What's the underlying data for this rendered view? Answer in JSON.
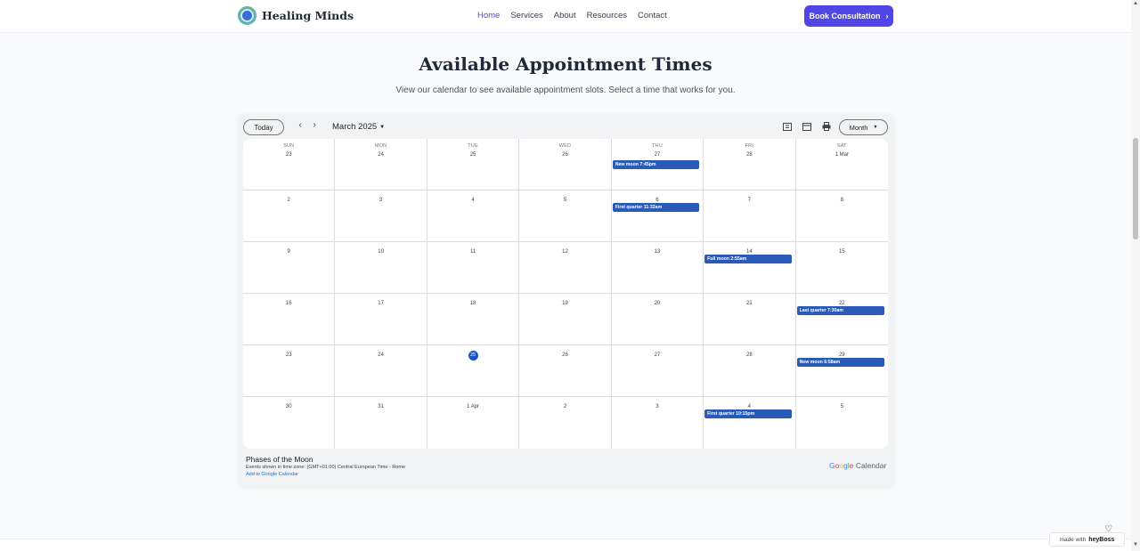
{
  "header": {
    "brand": "Healing Minds",
    "nav": [
      "Home",
      "Services",
      "About",
      "Resources",
      "Contact"
    ],
    "active_nav": "Home",
    "cta_label": "Book Consultation",
    "cta_icon": "chevron-right-icon",
    "accent_color": "#4f46e5"
  },
  "hero": {
    "title": "Available Appointment Times",
    "subtitle": "View our calendar to see available appointment slots. Select a time that works for you."
  },
  "calendar": {
    "today_label": "Today",
    "month_label": "March 2025",
    "view_label": "Month",
    "toolbar_icons": [
      "agenda-icon",
      "calendar-icon",
      "print-icon"
    ],
    "weekdays": [
      "SUN",
      "MON",
      "TUE",
      "WED",
      "THU",
      "FRI",
      "SAT"
    ],
    "weeks": [
      [
        "23",
        "24",
        "25",
        "26",
        "27",
        "28",
        "1 Mar"
      ],
      [
        "2",
        "3",
        "4",
        "5",
        "6",
        "7",
        "8"
      ],
      [
        "9",
        "10",
        "11",
        "12",
        "13",
        "14",
        "15"
      ],
      [
        "16",
        "17",
        "18",
        "19",
        "20",
        "21",
        "22"
      ],
      [
        "23",
        "24",
        "25",
        "26",
        "27",
        "28",
        "29"
      ],
      [
        "30",
        "31",
        "1 Apr",
        "2",
        "3",
        "4",
        "5"
      ]
    ],
    "today": {
      "week": 4,
      "day": 2
    },
    "events": [
      {
        "week": 0,
        "day": 4,
        "label": "New moon 7:45pm"
      },
      {
        "week": 1,
        "day": 4,
        "label": "First quarter 11:32am"
      },
      {
        "week": 2,
        "day": 5,
        "label": "Full moon 2:55am"
      },
      {
        "week": 3,
        "day": 6,
        "label": "Last quarter 7:30am"
      },
      {
        "week": 4,
        "day": 6,
        "label": "New moon 6:58am"
      },
      {
        "week": 5,
        "day": 5,
        "label": "First quarter 10:15pm"
      }
    ],
    "event_color": "#2a5ab8",
    "calendar_name": "Phases of the Moon",
    "timezone_note": "Events shown in time zone: (GMT+01:00) Central European Time - Rome",
    "add_link": "Add to Google Calendar",
    "brand_google": "Google",
    "brand_calendar": "Calendar"
  },
  "badge": {
    "prefix": "made with",
    "brand": "heyBoss"
  }
}
